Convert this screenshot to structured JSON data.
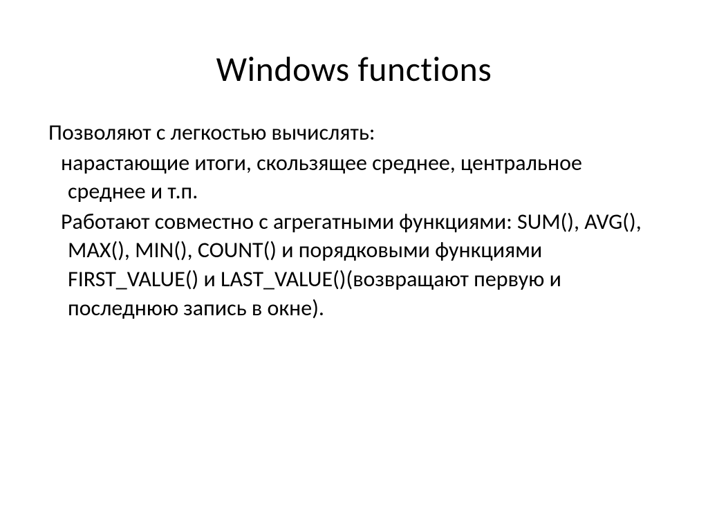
{
  "slide": {
    "title": "Windows functions",
    "para1": "Позволяют  с легкостью вычислять:",
    "para2": " нарастающие итоги,  скользящее среднее, центральное среднее и т.п.",
    "para3": " Работают совместно с агрегатными функциями: SUM(), AVG(), MAX(), MIN(), COUNT() и порядковыми функциями FIRST_VALUE() и LAST_VALUE()(возвращают первую и последнюю запись в окне)."
  }
}
